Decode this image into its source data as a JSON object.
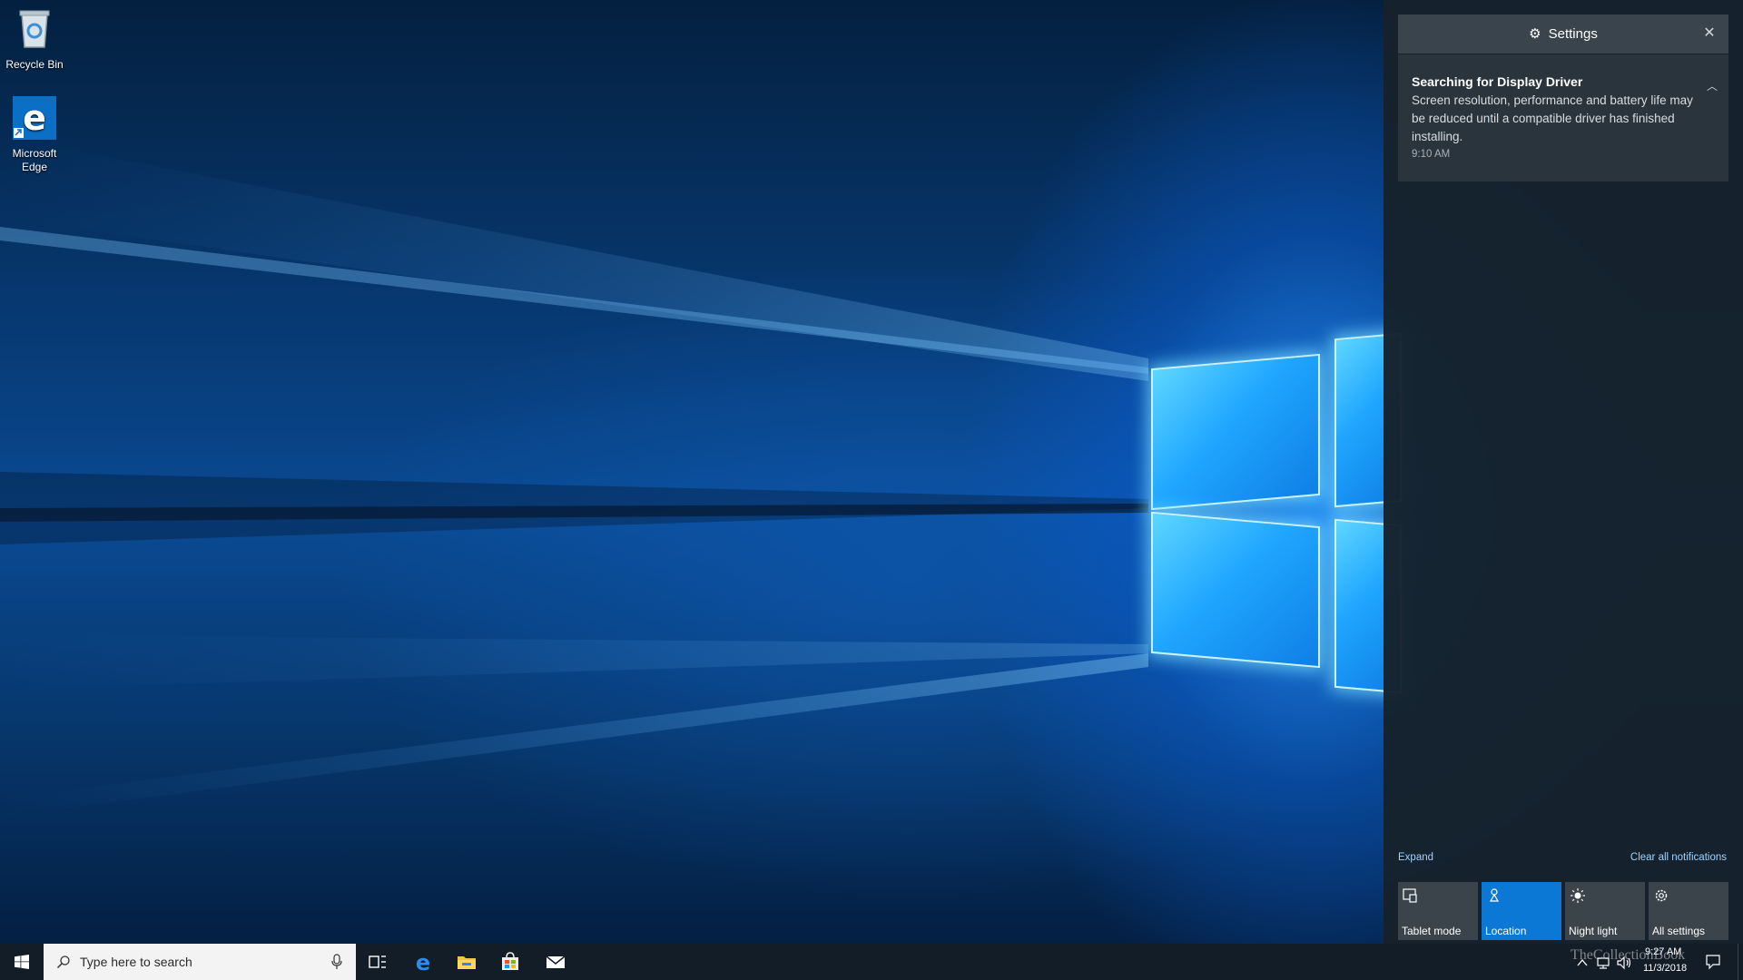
{
  "desktop": {
    "icons": [
      {
        "label": "Recycle Bin"
      },
      {
        "label": "Microsoft Edge"
      }
    ]
  },
  "action_center": {
    "header_title": "Settings",
    "notification": {
      "title": "Searching for Display Driver",
      "body": "Screen resolution, performance and battery life may be reduced until a compatible driver has finished installing.",
      "time": "9:10 AM"
    },
    "expand_label": "Expand",
    "clear_label": "Clear all notifications",
    "quick_actions": [
      {
        "label": "Tablet mode",
        "icon": "tablet-icon",
        "active": false
      },
      {
        "label": "Location",
        "icon": "location-icon",
        "active": true
      },
      {
        "label": "Night light",
        "icon": "night-light-icon",
        "active": false
      },
      {
        "label": "All settings",
        "icon": "gear-icon",
        "active": false
      }
    ]
  },
  "taskbar": {
    "search_placeholder": "Type here to search",
    "clock_time": "9:27 AM",
    "clock_date": "11/3/2018",
    "pinned": [
      "task-view-icon",
      "edge-icon",
      "file-explorer-icon",
      "store-icon",
      "mail-icon"
    ]
  },
  "watermark": "TheCollectionBook",
  "colors": {
    "accent": "#0b78d6",
    "action_center_bg": "#16222c",
    "notification_card": "#2a343c",
    "taskbar": "#121d28"
  }
}
